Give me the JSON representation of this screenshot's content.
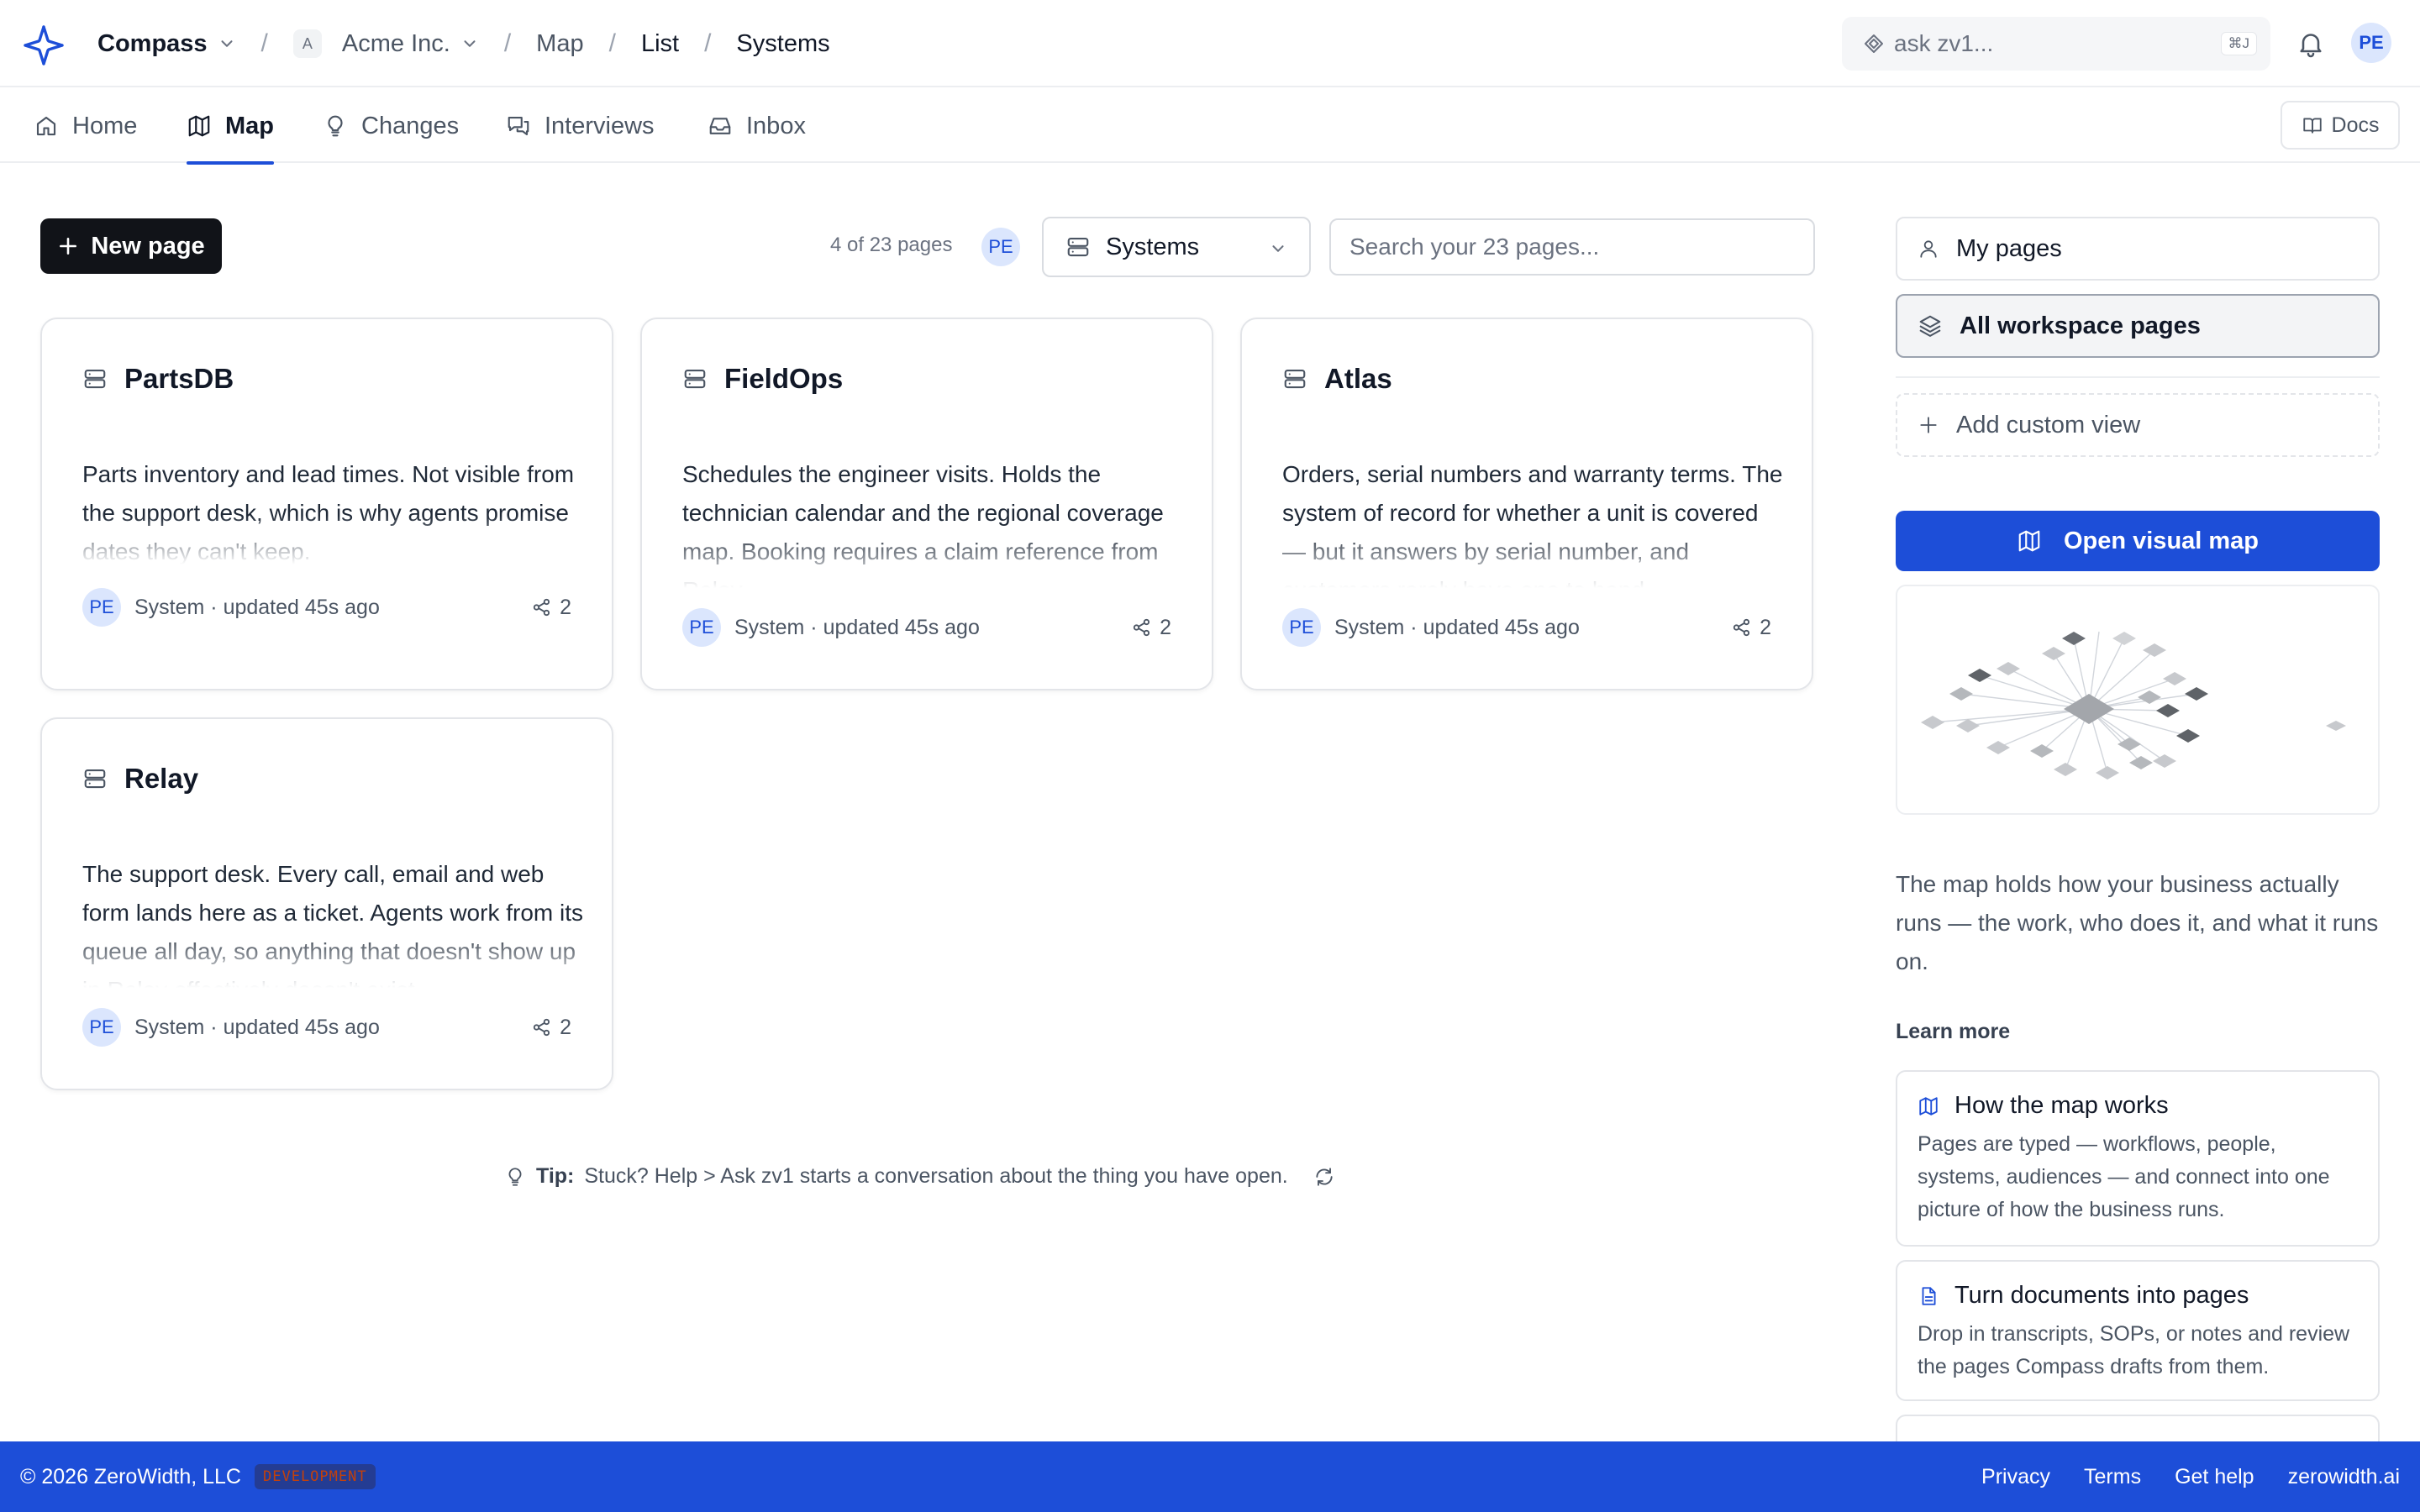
{
  "header": {
    "app_name": "Compass",
    "org": {
      "initial": "A",
      "name": "Acme Inc."
    },
    "breadcrumbs": [
      "Map",
      "List",
      "Systems"
    ],
    "ask": {
      "placeholder": "ask zv1...",
      "shortcut": "⌘J"
    },
    "user_initials": "PE"
  },
  "nav": {
    "tabs": [
      {
        "label": "Home",
        "icon": "home-icon",
        "active": false
      },
      {
        "label": "Map",
        "icon": "map-icon",
        "active": true
      },
      {
        "label": "Changes",
        "icon": "lightbulb-icon",
        "active": false
      },
      {
        "label": "Interviews",
        "icon": "chat-icon",
        "active": false
      },
      {
        "label": "Inbox",
        "icon": "inbox-icon",
        "active": false
      }
    ],
    "docs_label": "Docs"
  },
  "toolbar": {
    "new_page_label": "New page",
    "count_text": "4 of 23 pages",
    "filter_initials": "PE",
    "type_filter": "Systems",
    "search_placeholder": "Search your 23 pages..."
  },
  "cards": [
    {
      "title": "PartsDB",
      "description": "Parts inventory and lead times. Not visible from the support desk, which is why agents promise dates they can't keep.",
      "author_initials": "PE",
      "meta": "System · updated 45s ago",
      "link_count": "2"
    },
    {
      "title": "FieldOps",
      "description": "Schedules the engineer visits. Holds the technician calendar and the regional coverage map. Booking requires a claim reference from Relay.",
      "author_initials": "PE",
      "meta": "System · updated 45s ago",
      "link_count": "2"
    },
    {
      "title": "Atlas",
      "description": "Orders, serial numbers and warranty terms. The system of record for whether a unit is covered — but it answers by serial number, and customers rarely have one to hand.",
      "author_initials": "PE",
      "meta": "System · updated 45s ago",
      "link_count": "2"
    },
    {
      "title": "Relay",
      "description": "The support desk. Every call, email and web form lands here as a ticket. Agents work from its queue all day, so anything that doesn't show up in Relay effectively doesn't exist.",
      "author_initials": "PE",
      "meta": "System · updated 45s ago",
      "link_count": "2"
    }
  ],
  "tip": {
    "label": "Tip:",
    "text": "Stuck? Help > Ask zv1 starts a conversation about the thing you have open."
  },
  "sidebar": {
    "views": [
      {
        "label": "My pages",
        "icon": "user-icon",
        "selected": false
      },
      {
        "label": "All workspace pages",
        "icon": "layers-icon",
        "selected": true
      }
    ],
    "add_view_label": "Add custom view",
    "open_map_label": "Open visual map",
    "about_text": "The map holds how your business actually runs — the work, who does it, and what it runs on.",
    "learn_more_label": "Learn more",
    "learn_items": [
      {
        "title": "How the map works",
        "icon": "map-icon",
        "description": "Pages are typed — workflows, people, systems, audiences — and connect into one picture of how the business runs."
      },
      {
        "title": "Turn documents into pages",
        "icon": "document-icon",
        "description": "Drop in transcripts, SOPs, or notes and review the pages Compass drafts from them."
      }
    ]
  },
  "footer": {
    "copyright": "© 2026 ZeroWidth, LLC",
    "env_badge": "DEVELOPMENT",
    "links": [
      "Privacy",
      "Terms",
      "Get help",
      "zerowidth.ai"
    ]
  }
}
